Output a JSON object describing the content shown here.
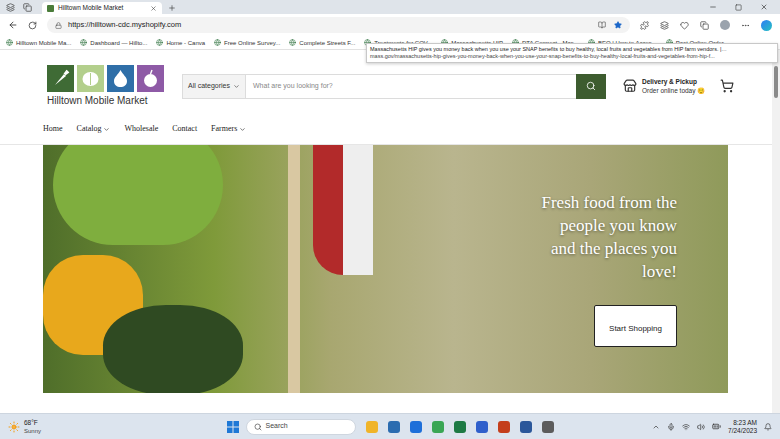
{
  "browser": {
    "tab": {
      "title": "Hilltown Mobile Market",
      "selected": true
    },
    "url": "https://hilltown-cdc.myshopify.com",
    "bookmarks": [
      "Hilltown Mobile Ma...",
      "Dashboard — Hillto...",
      "Home - Canva",
      "Free Online Survey...",
      "Complete Streets F...",
      "Treatments for COV...",
      "Massachusetts HIP",
      "DTA Connect - Mas...",
      "BEO | How to Acces...",
      "Past Online Order..."
    ],
    "tooltip": {
      "text": "Massachusetts HIP gives you money back when you use your SNAP benefits to buy healthy, local fruits and vegetables from HIP farm vendors. |…",
      "url": "mass.gov/massachusetts-hip-gives-you-money-back-when-you-use-your-snap-benefits-to-buy-healthy-local-fruits-and-vegetables-from-hip-f..."
    }
  },
  "site": {
    "logo": "Hilltown Mobile Market",
    "search": {
      "category": "All categories",
      "placeholder": "What are you looking for?"
    },
    "delivery": {
      "title": "Delivery & Pickup",
      "subtitle": "Order online today 😊"
    },
    "nav": [
      {
        "label": "Home",
        "dropdown": false
      },
      {
        "label": "Catalog",
        "dropdown": true
      },
      {
        "label": "Wholesale",
        "dropdown": false
      },
      {
        "label": "Contact",
        "dropdown": false
      },
      {
        "label": "Farmers",
        "dropdown": true
      }
    ],
    "hero": {
      "headline_lines": [
        "Fresh food from the",
        "people you know",
        "and the places you",
        "love!"
      ],
      "button": "Start Shopping"
    }
  },
  "taskbar": {
    "weather": {
      "temp": "68°F",
      "condition": "Sunny"
    },
    "search": "Search",
    "time": "8:23 AM",
    "date": "7/24/2023"
  }
}
